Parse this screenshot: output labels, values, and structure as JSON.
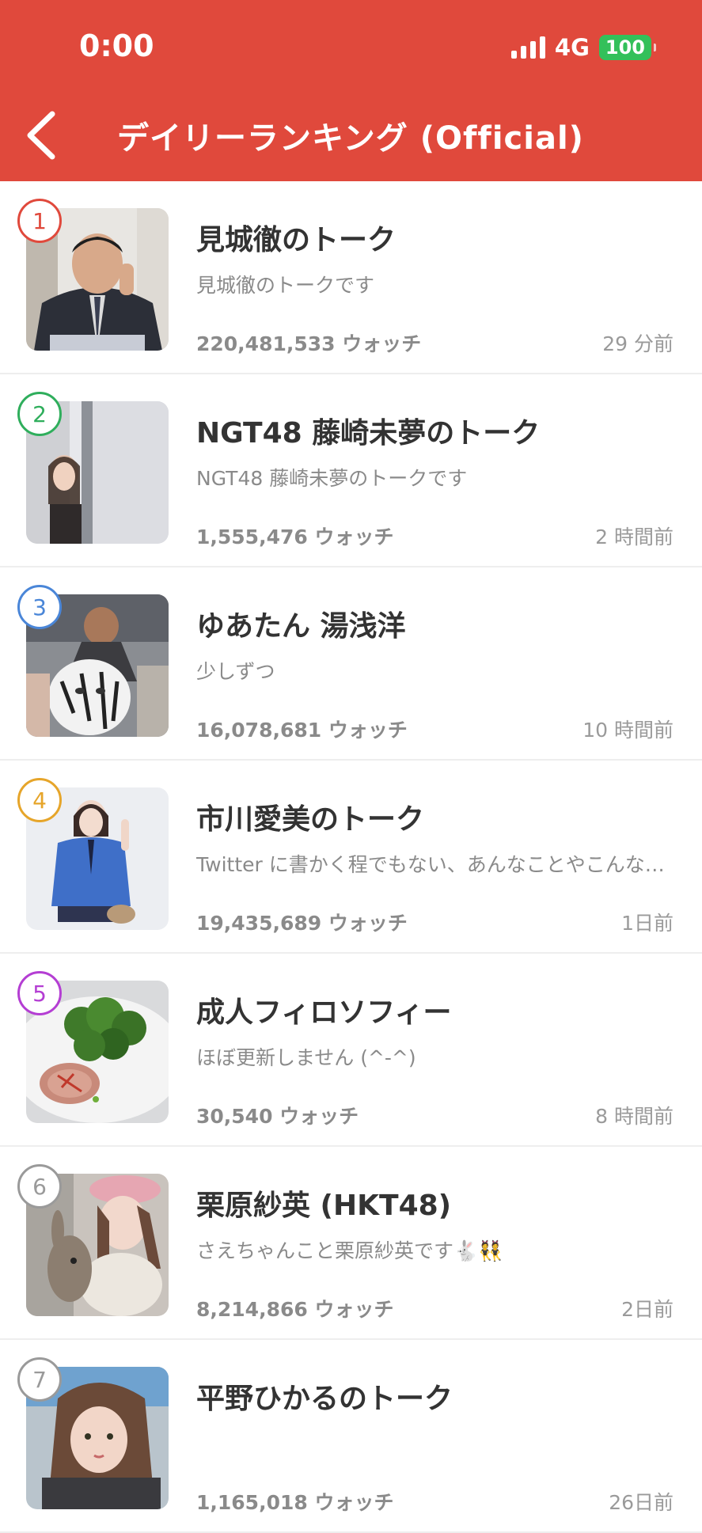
{
  "status_bar": {
    "time": "0:00",
    "network": "4G",
    "battery": "100"
  },
  "header": {
    "title": "デイリーランキング (Official)"
  },
  "colors": {
    "header_bg": "#e0493c",
    "battery": "#33c05a"
  },
  "rankings": [
    {
      "rank": "1",
      "name": "見城徹のトーク",
      "description": "見城徹のトークです",
      "watch": "220,481,533 ウォッチ",
      "time": "29 分前",
      "rank_color": "#e0493c"
    },
    {
      "rank": "2",
      "name": "NGT48 藤崎未夢のトーク",
      "description": "NGT48 藤崎未夢のトークです",
      "watch": "1,555,476 ウォッチ",
      "time": "2 時間前",
      "rank_color": "#2fae5c"
    },
    {
      "rank": "3",
      "name": "ゆあたん 湯浅洋",
      "description": "少しずつ",
      "watch": "16,078,681 ウォッチ",
      "time": "10 時間前",
      "rank_color": "#4a86d8"
    },
    {
      "rank": "4",
      "name": "市川愛美のトーク",
      "description": "Twitter に書かく程でもない、あんなことやこんな…",
      "watch": "19,435,689 ウォッチ",
      "time": "1日前",
      "rank_color": "#e6a52a"
    },
    {
      "rank": "5",
      "name": "成人フィロソフィー",
      "description": "ほぼ更新しません (^-^)",
      "watch": "30,540 ウォッチ",
      "time": "8 時間前",
      "rank_color": "#b43ed3"
    },
    {
      "rank": "6",
      "name": "栗原紗英 (HKT48)",
      "description": "さえちゃんこと栗原紗英です🐇👯",
      "watch": "8,214,866 ウォッチ",
      "time": "2日前",
      "rank_color": "#9a9a9a"
    },
    {
      "rank": "7",
      "name": "平野ひかるのトーク",
      "description": "",
      "watch": "1,165,018 ウォッチ",
      "time": "26日前",
      "rank_color": "#9a9a9a"
    }
  ]
}
